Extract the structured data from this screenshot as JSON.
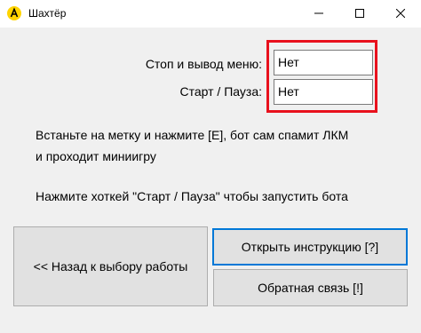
{
  "window": {
    "title": "Шахтёр",
    "icon": "yellow-circle-a-icon",
    "accent_color": "#ffd400",
    "controls": [
      "minimize-icon",
      "maximize-icon",
      "close-icon"
    ]
  },
  "hotkeys": {
    "stop_label": "Стоп и вывод меню:",
    "stop_value": "Нет",
    "start_label": "Старт / Пауза:",
    "start_value": "Нет",
    "highlight_color": "#e8111d"
  },
  "instructions": {
    "line1": "Встаньте на метку и нажмите [E], бот сам спамит ЛКМ",
    "line2": "и проходит миниигру",
    "line3": "Нажмите хоткей \"Старт / Пауза\" чтобы запустить бота"
  },
  "buttons": {
    "back": "<< Назад к выбору работы",
    "open_instructions": "Открыть инструкцию [?]",
    "feedback": "Обратная связь [!]"
  }
}
